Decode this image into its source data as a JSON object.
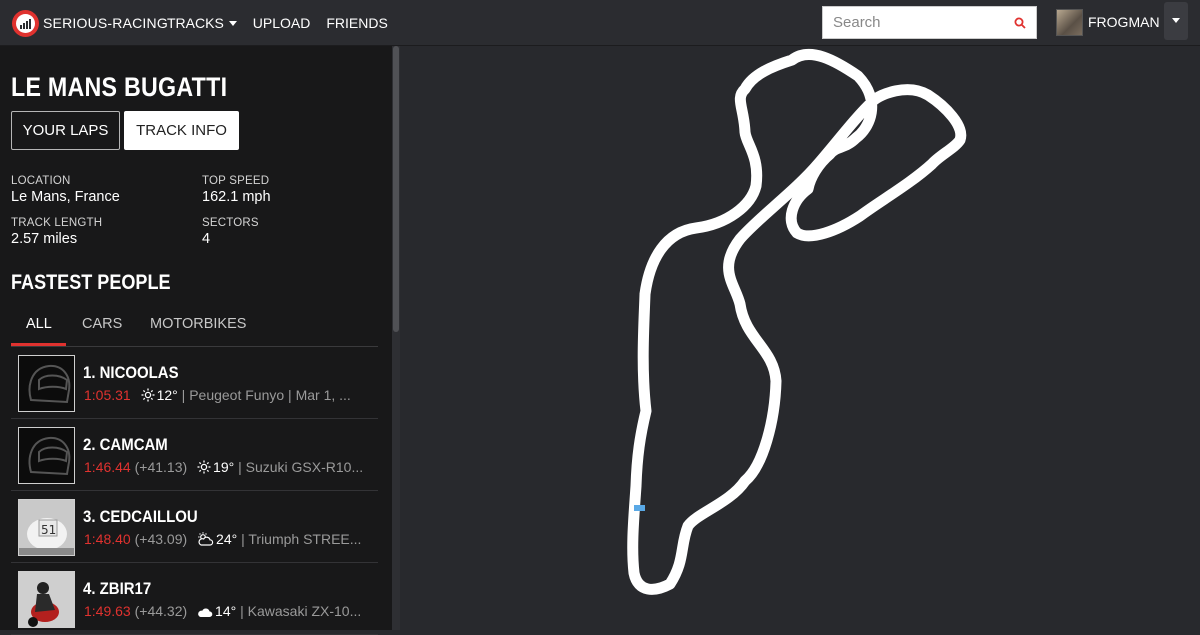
{
  "brand": {
    "name": "SERIOUS-RACING",
    "icon": "speedometer-logo-icon"
  },
  "nav": {
    "tracks": "TRACKS",
    "upload": "UPLOAD",
    "friends": "FRIENDS"
  },
  "search": {
    "placeholder": "Search",
    "icon": "search-icon"
  },
  "user": {
    "name": "FROGMAN"
  },
  "track": {
    "name": "LE MANS BUGATTI",
    "btn_laps": "YOUR LAPS",
    "btn_info": "TRACK INFO",
    "location_label": "LOCATION",
    "location": "Le Mans, France",
    "topspeed_label": "TOP SPEED",
    "topspeed": "162.1 mph",
    "length_label": "TRACK LENGTH",
    "length": "2.57 miles",
    "sectors_label": "SECTORS",
    "sectors": "4"
  },
  "fastest": {
    "heading": "FASTEST PEOPLE",
    "tabs": [
      "ALL",
      "CARS",
      "MOTORBIKES"
    ],
    "rows": [
      {
        "name": "1. NICOOLAS",
        "time": "1:05.31",
        "gap": "",
        "weather": "sun-icon",
        "temp": "12°",
        "rest": " | Peugeot Funyo | Mar 1, ..."
      },
      {
        "name": "2. CAMCAM",
        "time": "1:46.44",
        "gap": " (+41.13)",
        "weather": "sun-icon",
        "temp": "19°",
        "rest": " | Suzuki GSX-R10..."
      },
      {
        "name": "3. CEDCAILLOU",
        "time": "1:48.40",
        "gap": " (+43.09)",
        "weather": "partly-cloudy-icon",
        "temp": "24°",
        "rest": " | Triumph STREE..."
      },
      {
        "name": "4. ZBIR17",
        "time": "1:49.63",
        "gap": " (+44.32)",
        "weather": "cloud-icon",
        "temp": "14°",
        "rest": " | Kawasaki ZX-10..."
      }
    ]
  },
  "colors": {
    "accent": "#e0322f",
    "start_marker": "#5aa9e6",
    "track": "#ffffff"
  }
}
